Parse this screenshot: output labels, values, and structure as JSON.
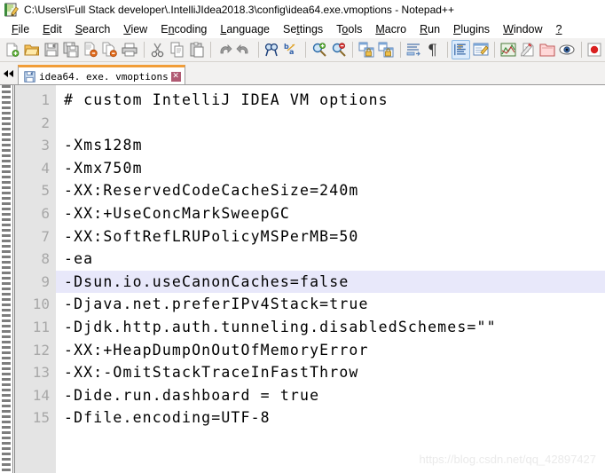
{
  "window": {
    "title": "C:\\Users\\Full Stack developer\\.IntelliJIdea2018.3\\config\\idea64.exe.vmoptions - Notepad++",
    "icon": "notepad-plus-plus-icon"
  },
  "menubar": {
    "items": [
      {
        "label": "File",
        "mnemonic": "F"
      },
      {
        "label": "Edit",
        "mnemonic": "E"
      },
      {
        "label": "Search",
        "mnemonic": "S"
      },
      {
        "label": "View",
        "mnemonic": "V"
      },
      {
        "label": "Encoding",
        "mnemonic": "n"
      },
      {
        "label": "Language",
        "mnemonic": "L"
      },
      {
        "label": "Settings",
        "mnemonic": "t"
      },
      {
        "label": "Tools",
        "mnemonic": "o"
      },
      {
        "label": "Macro",
        "mnemonic": "M"
      },
      {
        "label": "Run",
        "mnemonic": "R"
      },
      {
        "label": "Plugins",
        "mnemonic": "P"
      },
      {
        "label": "Window",
        "mnemonic": "W"
      },
      {
        "label": "?",
        "mnemonic": ""
      }
    ]
  },
  "toolbar": {
    "groups": [
      [
        "new-file-icon",
        "open-file-icon",
        "save-icon",
        "save-all-icon",
        "close-file-icon",
        "close-all-icon",
        "print-icon"
      ],
      [
        "cut-icon",
        "copy-icon",
        "paste-icon"
      ],
      [
        "undo-icon",
        "redo-icon"
      ],
      [
        "find-icon",
        "replace-icon"
      ],
      [
        "zoom-in-icon",
        "zoom-out-icon"
      ],
      [
        "sync-vertical-scroll-icon",
        "sync-horizontal-scroll-icon"
      ],
      [
        "word-wrap-icon",
        "show-all-characters-icon"
      ],
      [
        "indent-guide-icon",
        "user-defined-language-icon"
      ],
      [
        "show-document-map-icon",
        "show-function-list-icon",
        "show-folder-as-workspace-icon",
        "monitoring-icon"
      ],
      [
        "start-record-macro-icon"
      ]
    ],
    "active_button": "indent-guide-icon"
  },
  "tabbar": {
    "scroll_left": "scroll-tabs-left-icon",
    "tabs": [
      {
        "label": "idea64. exe. vmoptions",
        "icon": "saved-file-icon",
        "close": "✕",
        "active": true
      }
    ]
  },
  "editor": {
    "active_line": 9,
    "lines": [
      {
        "n": "1",
        "text": "# custom IntelliJ IDEA VM options"
      },
      {
        "n": "2",
        "text": ""
      },
      {
        "n": "3",
        "text": "-Xms128m"
      },
      {
        "n": "4",
        "text": "-Xmx750m"
      },
      {
        "n": "5",
        "text": "-XX:ReservedCodeCacheSize=240m"
      },
      {
        "n": "6",
        "text": "-XX:+UseConcMarkSweepGC"
      },
      {
        "n": "7",
        "text": "-XX:SoftRefLRUPolicyMSPerMB=50"
      },
      {
        "n": "8",
        "text": "-ea"
      },
      {
        "n": "9",
        "text": "-Dsun.io.useCanonCaches=false"
      },
      {
        "n": "10",
        "text": "-Djava.net.preferIPv4Stack=true"
      },
      {
        "n": "11",
        "text": "-Djdk.http.auth.tunneling.disabledSchemes=\"\""
      },
      {
        "n": "12",
        "text": "-XX:+HeapDumpOnOutOfMemoryError"
      },
      {
        "n": "13",
        "text": "-XX:-OmitStackTraceInFastThrow"
      },
      {
        "n": "14",
        "text": "-Dide.run.dashboard = true"
      },
      {
        "n": "15",
        "text": "-Dfile.encoding=UTF-8"
      }
    ]
  },
  "watermark": {
    "text": "https://blog.csdn.net/qq_42897427"
  },
  "colors": {
    "highlight_line": "#e8e8fa",
    "gutter": "#e4e4e4",
    "tab_active_top": "#f19d38",
    "toolbar_bg": "#f2f1f0",
    "active_toolbutton": "#dcebfb"
  }
}
